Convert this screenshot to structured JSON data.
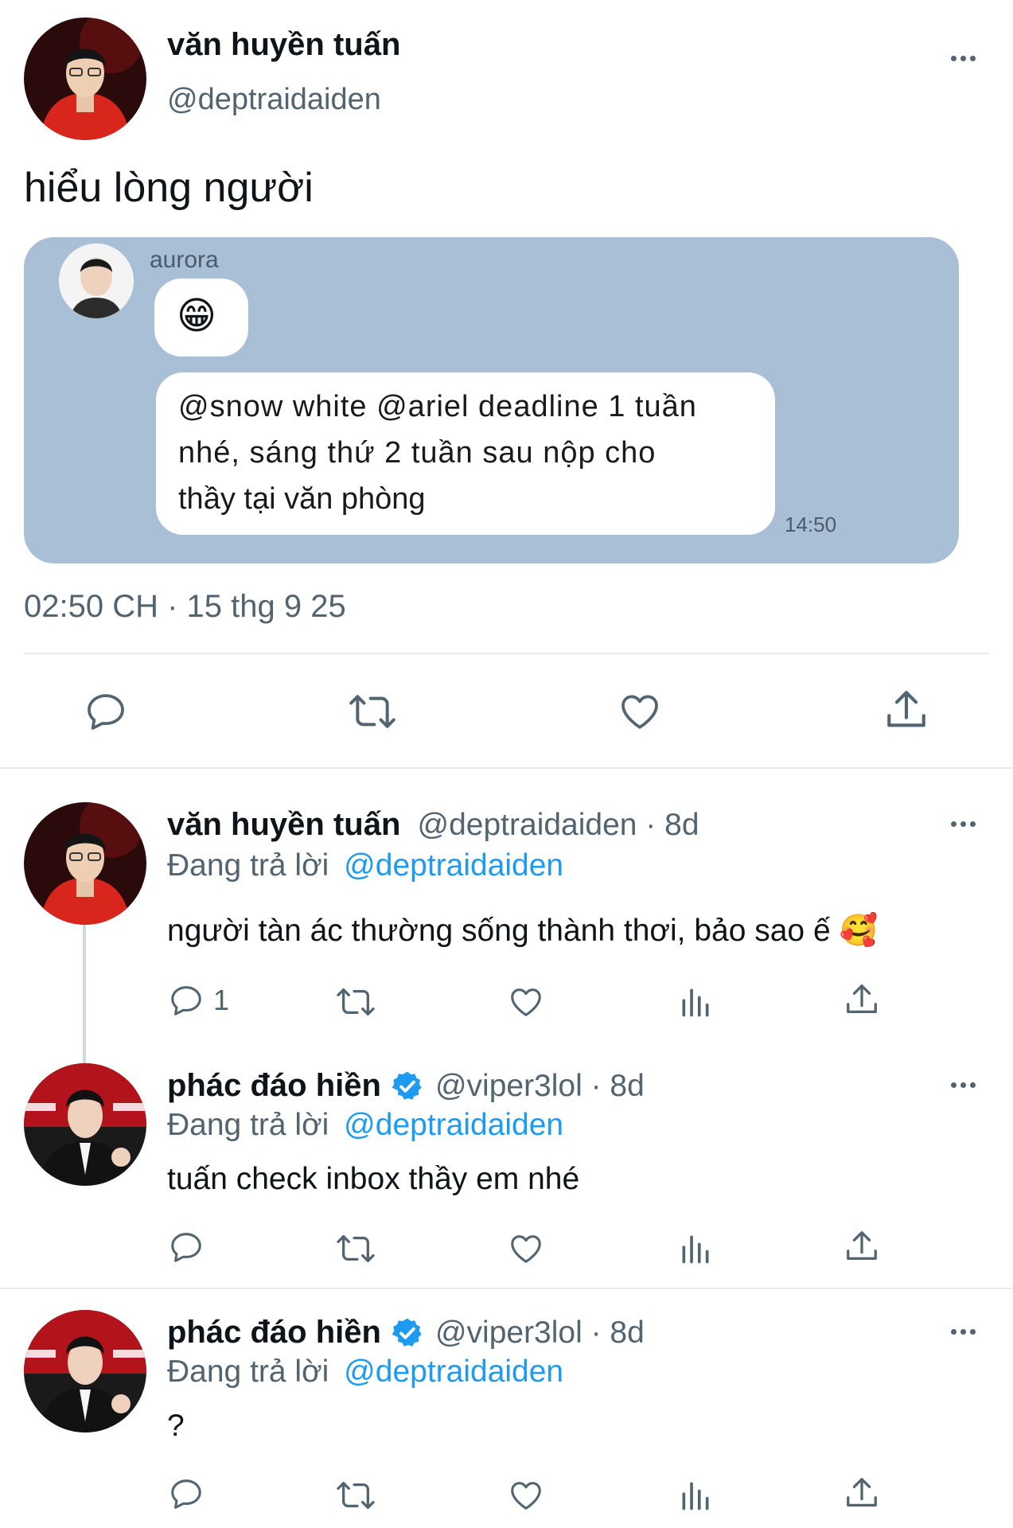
{
  "main_tweet": {
    "author_name": "văn huyền tuấn",
    "handle": "@deptraidaiden",
    "text": "hiểu lòng người",
    "timestamp": "02:50 CH · 15 thg 9 25",
    "embedded_chat": {
      "sender": "aurora",
      "emoji": "😁",
      "message_line1": "@snow white @ariel deadline 1 tuần",
      "message_line2": "nhé, sáng thứ 2 tuần sau nộp cho",
      "message_line3": "thầy tại văn phòng",
      "time": "14:50"
    }
  },
  "replies": [
    {
      "author_name": "văn huyền tuấn",
      "handle_time": "@deptraidaiden · 8d",
      "replying_label": "Đang trả lời",
      "replying_to": "@deptraidaiden",
      "text": "người tàn ác thường sống thành thơi, bảo sao ế 🥰",
      "reply_count": "1",
      "verified": false
    },
    {
      "author_name": "phác đáo hiền",
      "handle_time": "@viper3lol · 8d",
      "replying_label": "Đang trả lời",
      "replying_to": "@deptraidaiden",
      "text": "tuấn check inbox thầy em nhé",
      "reply_count": "",
      "verified": true
    },
    {
      "author_name": "phác đáo hiền",
      "handle_time": "@viper3lol · 8d",
      "replying_label": "Đang trả lời",
      "replying_to": "@deptraidaiden",
      "text": "?",
      "reply_count": "",
      "verified": true
    }
  ],
  "colors": {
    "accent": "#1d9bf0",
    "text": "#0f1419",
    "muted": "#536471",
    "card": "#a9bfd6",
    "divider": "#e7e9ea"
  }
}
